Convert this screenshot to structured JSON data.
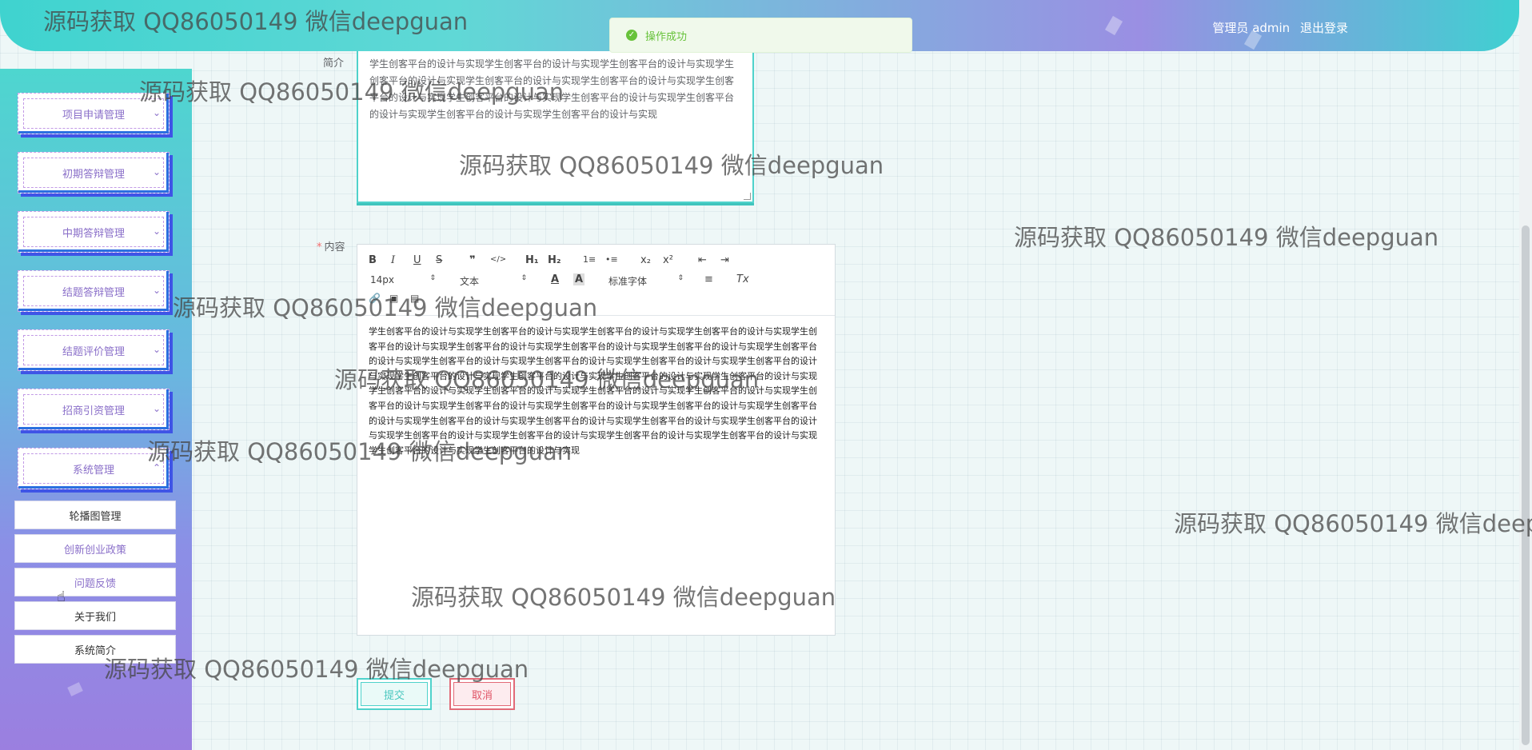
{
  "header": {
    "user_label": "管理员 admin",
    "logout_label": "退出登录"
  },
  "toast": {
    "message": "操作成功"
  },
  "sidebar": {
    "menus": [
      {
        "label": "项目申请管理"
      },
      {
        "label": "初期答辩管理"
      },
      {
        "label": "中期答辩管理"
      },
      {
        "label": "结题答辩管理"
      },
      {
        "label": "结题评价管理"
      },
      {
        "label": "招商引资管理"
      },
      {
        "label": "系统管理"
      }
    ],
    "submenu": [
      {
        "label": "轮播图管理"
      },
      {
        "label": "创新创业政策"
      },
      {
        "label": "问题反馈"
      },
      {
        "label": "关于我们"
      },
      {
        "label": "系统简介"
      }
    ]
  },
  "form": {
    "intro_label": "简介",
    "intro_value": "学生创客平台的设计与实现学生创客平台的设计与实现学生创客平台的设计与实现学生创客平台的设计与实现学生创客平台的设计与实现学生创客平台的设计与实现学生创客平台的设计与实现学生创客平台的设计与实现学生创客平台的设计与实现学生创客平台的设计与实现学生创客平台的设计与实现学生创客平台的设计与实现",
    "content_required_mark": "*",
    "content_label": "内容",
    "toolbar": {
      "bold": "B",
      "italic": "I",
      "underline": "U",
      "strike": "S",
      "quote": "❞",
      "code": "</>",
      "h1": "H₁",
      "h2": "H₂",
      "ordered": "1≡",
      "bullet": "•≡",
      "sub": "x₂",
      "sup": "x²",
      "outdent": "⇤",
      "indent": "⇥",
      "size": "14px",
      "header": "文本",
      "color": "A",
      "background": "A",
      "font": "标准字体",
      "align": "≡",
      "clean": "Tx",
      "link": "🔗",
      "image": "▣",
      "video": "▤"
    },
    "content_value": "学生创客平台的设计与实现学生创客平台的设计与实现学生创客平台的设计与实现学生创客平台的设计与实现学生创客平台的设计与实现学生创客平台的设计与实现学生创客平台的设计与实现学生创客平台的设计与实现学生创客平台的设计与实现学生创客平台的设计与实现学生创客平台的设计与实现学生创客平台的设计与实现学生创客平台的设计与实现学生创客平台的设计与实现学生创客平台的设计与实现学生创客平台的设计与实现学生创客平台的设计与实现学生创客平台的设计与实现学生创客平台的设计与实现学生创客平台的设计与实现学生创客平台的设计与实现学生创客平台的设计与实现学生创客平台的设计与实现学生创客平台的设计与实现学生创客平台的设计与实现学生创客平台的设计与实现学生创客平台的设计与实现学生创客平台的设计与实现学生创客平台的设计与实现学生创客平台的设计与实现学生创客平台的设计与实现学生创客平台的设计与实现学生创客平台的设计与实现学生创客平台的设计与实现学生创客平台的设计与实现学生创客平台的设计与实现",
    "submit_label": "提交",
    "cancel_label": "取消"
  },
  "watermark": "源码获取 QQ86050149 微信deepguan"
}
